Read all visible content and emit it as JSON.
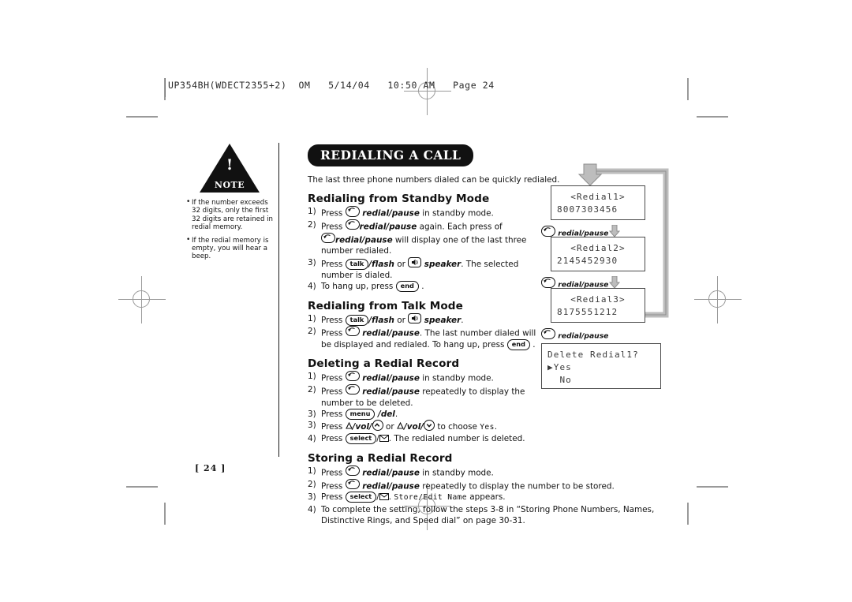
{
  "scan_header": "UP354BH(WDECT2355+2)  OM   5/14/04   10:50 AM   Page 24",
  "page_number": "[ 24 ]",
  "note": {
    "label": "NOTE",
    "bang": "!",
    "items": [
      "If the number exceeds 32 digits, only the first 32 digits are retained in redial memory.",
      "If the redial memory is empty, you will hear a beep."
    ]
  },
  "main": {
    "title": "REDIALING A CALL",
    "intro": "The last three phone numbers dialed can be quickly redialed.",
    "sections": [
      {
        "heading": "Redialing from Standby Mode",
        "steps": [
          {
            "num": "1)",
            "parts": [
              {
                "t": "text",
                "v": "Press "
              },
              {
                "t": "icon",
                "v": "redial-icon"
              },
              {
                "t": "bi",
                "v": " redial/pause"
              },
              {
                "t": "text",
                "v": " in standby mode."
              }
            ]
          },
          {
            "num": "2)",
            "parts": [
              {
                "t": "text",
                "v": "Press "
              },
              {
                "t": "icon",
                "v": "redial-icon"
              },
              {
                "t": "bi",
                "v": "redial/pause"
              },
              {
                "t": "text",
                "v": " again. Each press of"
              }
            ]
          },
          {
            "num": "",
            "cont": true,
            "parts": [
              {
                "t": "icon",
                "v": "redial-icon"
              },
              {
                "t": "bi",
                "v": "redial/pause"
              },
              {
                "t": "text",
                "v": " will display one of the last three"
              }
            ]
          },
          {
            "num": "",
            "cont": true,
            "parts": [
              {
                "t": "text",
                "v": "number redialed."
              }
            ]
          },
          {
            "num": "3)",
            "parts": [
              {
                "t": "text",
                "v": "Press "
              },
              {
                "t": "key",
                "v": "talk"
              },
              {
                "t": "bi",
                "v": "/flash"
              },
              {
                "t": "text",
                "v": " or "
              },
              {
                "t": "icon",
                "v": "speaker-icon"
              },
              {
                "t": "bi",
                "v": " speaker"
              },
              {
                "t": "text",
                "v": ". The selected"
              }
            ]
          },
          {
            "num": "",
            "cont": true,
            "parts": [
              {
                "t": "text",
                "v": "number is dialed."
              }
            ]
          },
          {
            "num": "4)",
            "parts": [
              {
                "t": "text",
                "v": "To hang up, press "
              },
              {
                "t": "key",
                "v": "end"
              },
              {
                "t": "text",
                "v": " ."
              }
            ]
          }
        ]
      },
      {
        "heading": "Redialing from Talk Mode",
        "steps": [
          {
            "num": "1)",
            "parts": [
              {
                "t": "text",
                "v": "Press "
              },
              {
                "t": "key",
                "v": "talk"
              },
              {
                "t": "bi",
                "v": "/flash"
              },
              {
                "t": "text",
                "v": " or "
              },
              {
                "t": "icon",
                "v": "speaker-icon"
              },
              {
                "t": "bi",
                "v": " speaker"
              },
              {
                "t": "text",
                "v": "."
              }
            ]
          },
          {
            "num": "2)",
            "parts": [
              {
                "t": "text",
                "v": "Press "
              },
              {
                "t": "icon",
                "v": "redial-icon"
              },
              {
                "t": "bi",
                "v": " redial/pause"
              },
              {
                "t": "text",
                "v": ". The last number dialed will"
              }
            ]
          },
          {
            "num": "",
            "cont": true,
            "parts": [
              {
                "t": "text",
                "v": "be displayed and redialed. To hang up, press "
              },
              {
                "t": "key",
                "v": "end"
              },
              {
                "t": "text",
                "v": " ."
              }
            ]
          }
        ]
      },
      {
        "heading": "Deleting a Redial Record",
        "steps": [
          {
            "num": "1)",
            "parts": [
              {
                "t": "text",
                "v": "Press "
              },
              {
                "t": "icon",
                "v": "redial-icon"
              },
              {
                "t": "bi",
                "v": " redial/pause"
              },
              {
                "t": "text",
                "v": " in standby mode."
              }
            ]
          },
          {
            "num": "2)",
            "parts": [
              {
                "t": "text",
                "v": "Press "
              },
              {
                "t": "icon",
                "v": "redial-icon"
              },
              {
                "t": "bi",
                "v": " redial/pause"
              },
              {
                "t": "text",
                "v": " repeatedly to display the"
              }
            ]
          },
          {
            "num": "",
            "cont": true,
            "parts": [
              {
                "t": "text",
                "v": "number to be deleted."
              }
            ]
          },
          {
            "num": "3)",
            "parts": [
              {
                "t": "text",
                "v": "Press "
              },
              {
                "t": "key",
                "v": "menu"
              },
              {
                "t": "bi",
                "v": " /del"
              },
              {
                "t": "text",
                "v": "."
              }
            ]
          },
          {
            "num": "3)",
            "parts": [
              {
                "t": "text",
                "v": "Press "
              },
              {
                "t": "icon",
                "v": "triangle-icon"
              },
              {
                "t": "bi",
                "v": "/vol/"
              },
              {
                "t": "icon",
                "v": "chevron-up-icon"
              },
              {
                "t": "text",
                "v": " or "
              },
              {
                "t": "icon",
                "v": "triangle-icon"
              },
              {
                "t": "bi",
                "v": "/vol/"
              },
              {
                "t": "icon",
                "v": "chevron-down-icon"
              },
              {
                "t": "text",
                "v": " to choose "
              },
              {
                "t": "lcd",
                "v": "Yes"
              },
              {
                "t": "text",
                "v": "."
              }
            ]
          },
          {
            "num": "4)",
            "parts": [
              {
                "t": "text",
                "v": "Press "
              },
              {
                "t": "key",
                "v": "select"
              },
              {
                "t": "text",
                "v": "/"
              },
              {
                "t": "icon",
                "v": "envelope-icon"
              },
              {
                "t": "text",
                "v": ". The redialed number is deleted."
              }
            ]
          }
        ]
      },
      {
        "heading": "Storing a Redial Record",
        "steps": [
          {
            "num": "1)",
            "parts": [
              {
                "t": "text",
                "v": "Press "
              },
              {
                "t": "icon",
                "v": "redial-icon"
              },
              {
                "t": "bi",
                "v": " redial/pause"
              },
              {
                "t": "text",
                "v": " in standby mode."
              }
            ]
          },
          {
            "num": "2)",
            "parts": [
              {
                "t": "text",
                "v": "Press "
              },
              {
                "t": "icon",
                "v": "redial-icon"
              },
              {
                "t": "bi",
                "v": " redial/pause"
              },
              {
                "t": "text",
                "v": " repeatedly to display the number to be stored."
              }
            ]
          },
          {
            "num": "3)",
            "parts": [
              {
                "t": "text",
                "v": "Press "
              },
              {
                "t": "key",
                "v": "select"
              },
              {
                "t": "text",
                "v": "/"
              },
              {
                "t": "icon",
                "v": "envelope-icon"
              },
              {
                "t": "text",
                "v": ". "
              },
              {
                "t": "lcd",
                "v": "Store/Edit Name"
              },
              {
                "t": "text",
                "v": " appears."
              }
            ]
          },
          {
            "num": "4)",
            "parts": [
              {
                "t": "text",
                "v": "To complete the setting, follow the steps 3-8 in “Storing Phone Numbers, Names,"
              }
            ]
          },
          {
            "num": "",
            "cont": true,
            "parts": [
              {
                "t": "text",
                "v": "Distinctive Rings, and Speed dial” on page 30-31."
              }
            ]
          }
        ]
      }
    ]
  },
  "diagram": {
    "screens": [
      {
        "title": "<Redial1>",
        "value": "8007303456"
      },
      {
        "title": "<Redial2>",
        "value": "2145452930"
      },
      {
        "title": "<Redial3>",
        "value": "8175551212"
      }
    ],
    "transition_label": "redial/pause",
    "delete_screen": {
      "line1": "Delete Redial1?",
      "line2": "▶Yes",
      "line3": "  No"
    }
  }
}
